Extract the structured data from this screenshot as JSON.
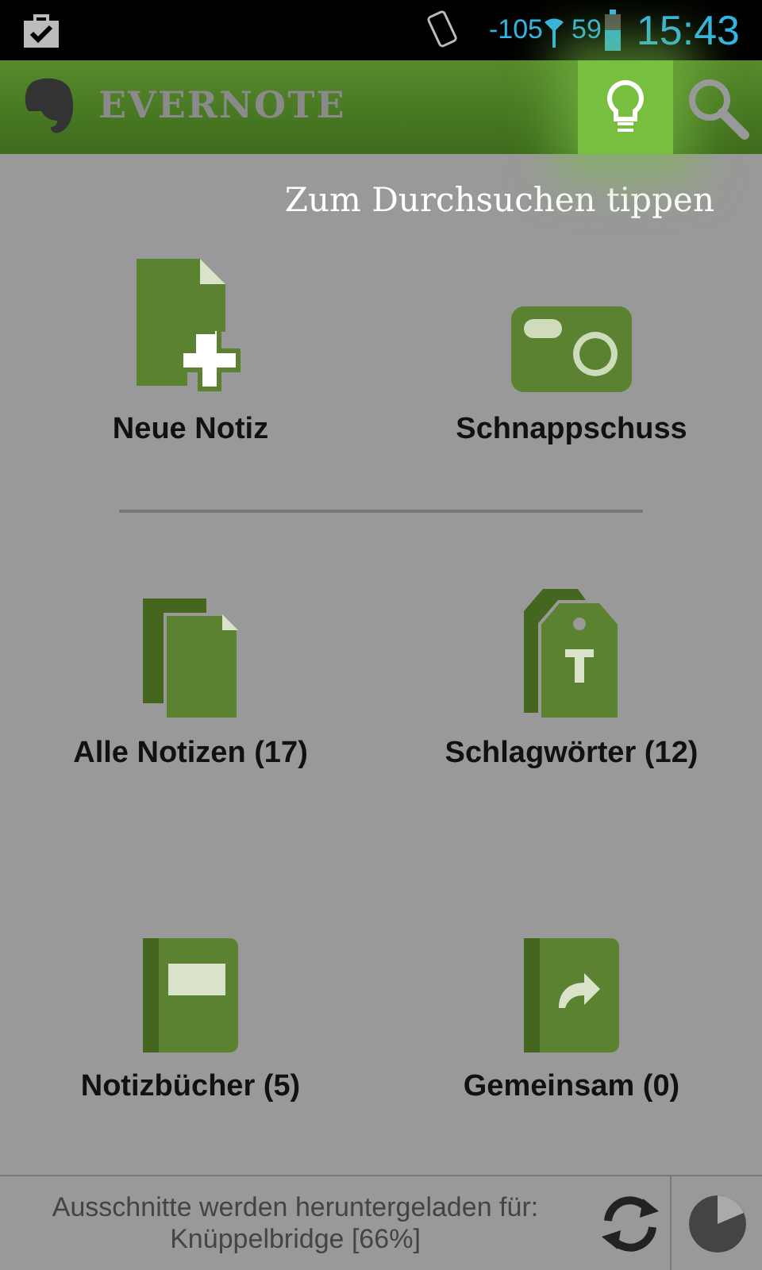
{
  "status_bar": {
    "signal_reading": "-105",
    "battery": "59",
    "time": "15:43"
  },
  "app_bar": {
    "title": "EVERNOTE"
  },
  "hint": "Zum Durchsuchen tippen",
  "sections": [
    [
      {
        "kind": "new-note",
        "label": "Neue Notiz"
      },
      {
        "kind": "snapshot",
        "label": "Schnappschuss"
      }
    ],
    [
      {
        "kind": "notes",
        "label": "Alle Notizen (17)"
      },
      {
        "kind": "tags",
        "label": "Schlagwörter (12)"
      },
      {
        "kind": "notebooks",
        "label": "Notizbücher (5)"
      },
      {
        "kind": "shared",
        "label": "Gemeinsam (0)"
      }
    ]
  ],
  "sync_bar": {
    "lines": [
      "Ausschnitte werden heruntergeladen für:",
      "Knüppelbridge [66%]"
    ]
  }
}
